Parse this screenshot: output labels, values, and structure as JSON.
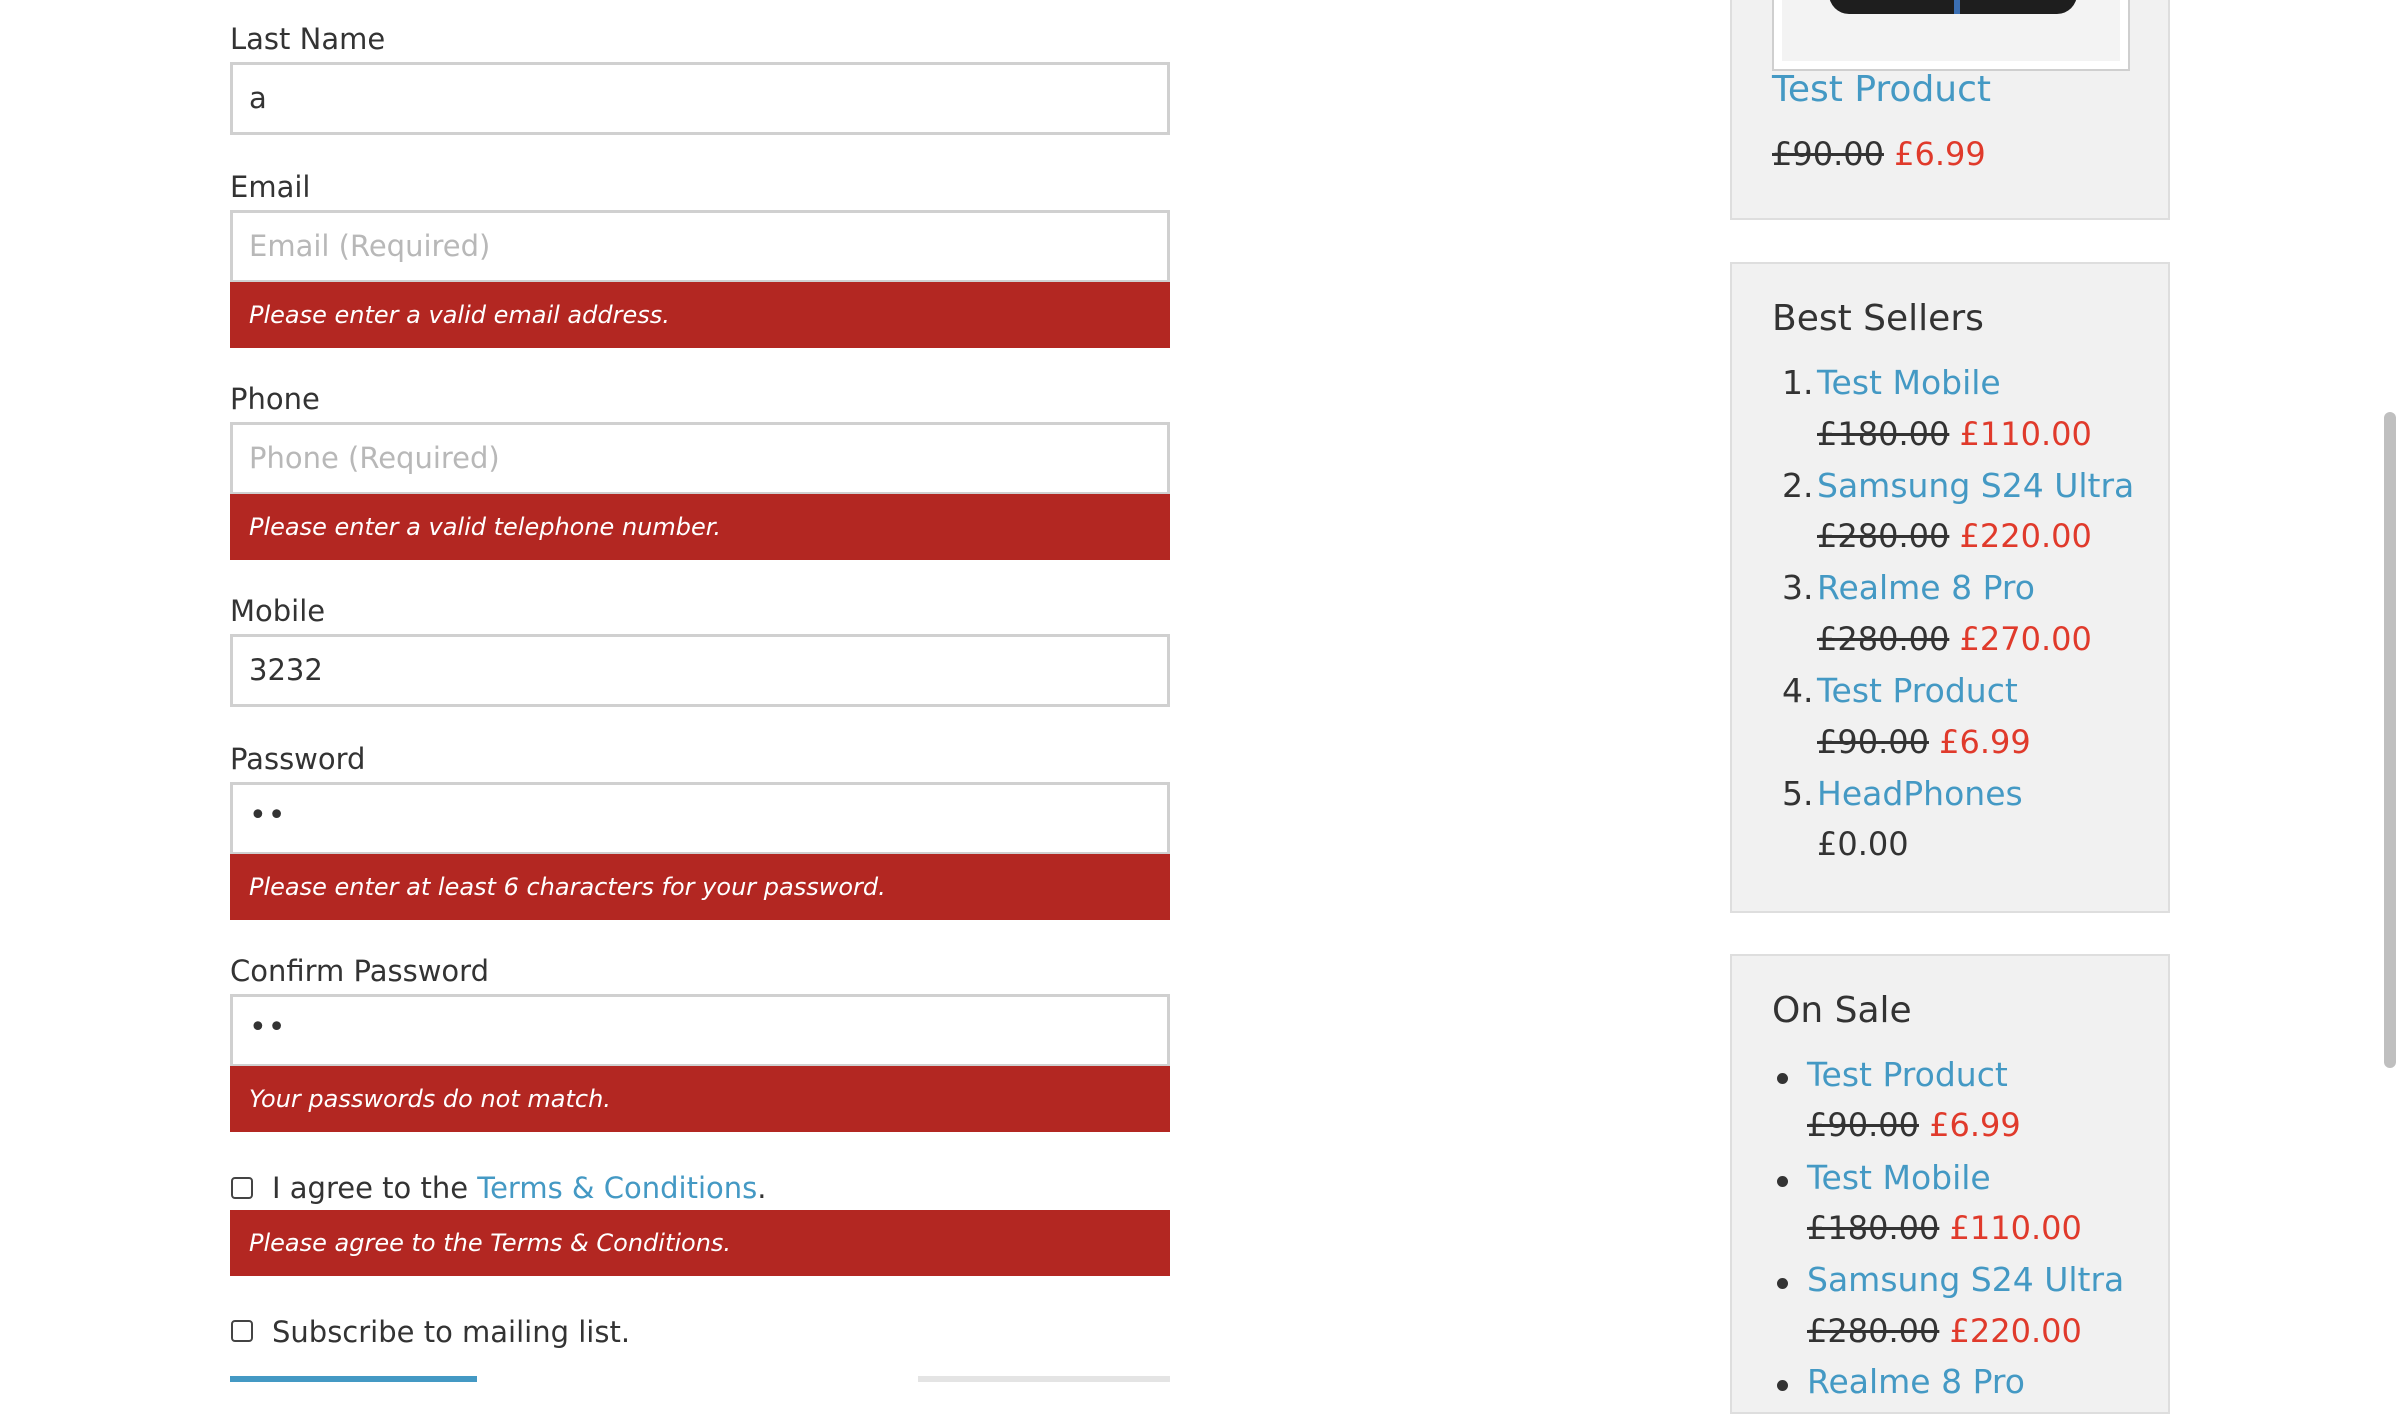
{
  "form": {
    "last_name": {
      "label": "Last Name",
      "value": "a"
    },
    "email": {
      "label": "Email",
      "placeholder": "Email  (Required)",
      "error": "Please enter a valid email address."
    },
    "phone": {
      "label": "Phone",
      "placeholder": "Phone (Required)",
      "error": "Please enter a valid telephone number."
    },
    "mobile": {
      "label": "Mobile",
      "value": "3232"
    },
    "password": {
      "label": "Password",
      "value": "••",
      "error": "Please enter at least 6 characters for your password."
    },
    "confirm_password": {
      "label": "Confirm Password",
      "value": "••",
      "error": "Your passwords do not match."
    },
    "terms": {
      "prefix": "I agree to the ",
      "link": "Terms & Conditions",
      "suffix": ".",
      "error": "Please agree to the Terms & Conditions."
    },
    "subscribe": {
      "label": "Subscribe to mailing list."
    }
  },
  "sidebar": {
    "top_product": {
      "name": "Test Product",
      "old_price": "£90.00",
      "new_price": "£6.99"
    },
    "best_sellers": {
      "title": "Best Sellers",
      "items": [
        {
          "num": "1.",
          "name": "Test Mobile",
          "old_price": "£180.00",
          "new_price": "£110.00"
        },
        {
          "num": "2.",
          "name": "Samsung S24 Ultra",
          "old_price": "£280.00",
          "new_price": "£220.00"
        },
        {
          "num": "3.",
          "name": "Realme 8 Pro",
          "old_price": "£280.00",
          "new_price": "£270.00"
        },
        {
          "num": "4.",
          "name": "Test Product",
          "old_price": "£90.00",
          "new_price": "£6.99"
        },
        {
          "num": "5.",
          "name": "HeadPhones",
          "price": "£0.00"
        }
      ]
    },
    "on_sale": {
      "title": "On Sale",
      "items": [
        {
          "name": "Test Product",
          "old_price": "£90.00",
          "new_price": "£6.99"
        },
        {
          "name": "Test Mobile",
          "old_price": "£180.00",
          "new_price": "£110.00"
        },
        {
          "name": "Samsung S24 Ultra",
          "old_price": "£280.00",
          "new_price": "£220.00"
        },
        {
          "name": "Realme 8 Pro"
        }
      ]
    }
  },
  "colors": {
    "error_bg": "#b32722",
    "link": "#4499c4",
    "sale_price": "#e03a2b",
    "widget_bg": "#f1f1f1"
  }
}
